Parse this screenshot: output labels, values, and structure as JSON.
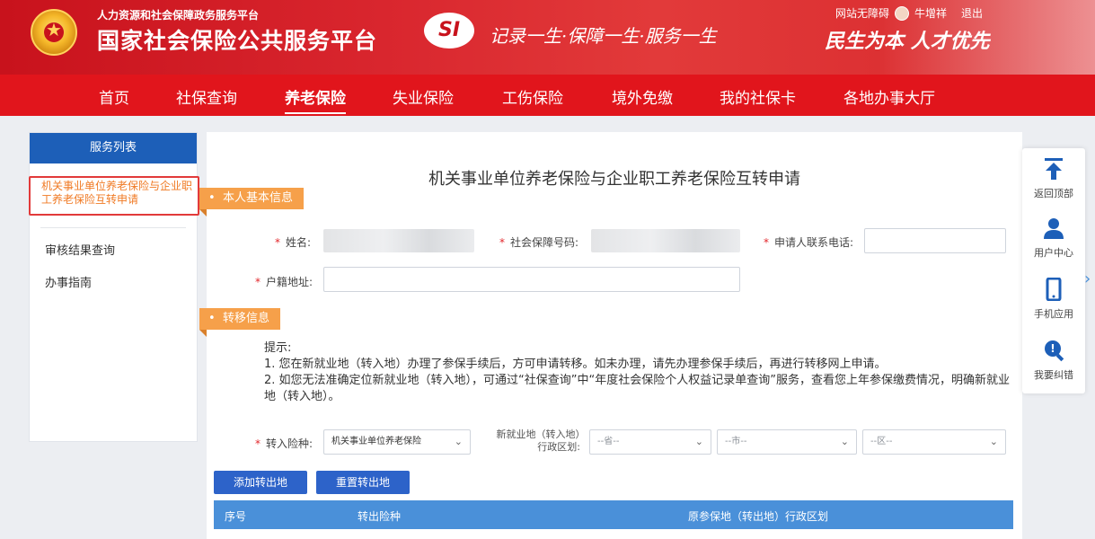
{
  "header": {
    "sub_title": "人力资源和社会保障政务服务平台",
    "main_title": "国家社会保险公共服务平台",
    "si_logo": "SI",
    "slogan": "记录一生·保障一生·服务一生",
    "slogan2": "民生为本 人才优先",
    "barrier_free": "网站无障碍",
    "username": "牛增祥",
    "logout": "退出"
  },
  "nav": {
    "items": [
      "首页",
      "社保查询",
      "养老保险",
      "失业保险",
      "工伤保险",
      "境外免缴",
      "我的社保卡",
      "各地办事大厅"
    ],
    "active_index": 2
  },
  "sidebar": {
    "header": "服务列表",
    "selected_item": "机关事业单位养老保险与企业职工养老保险互转申请",
    "items": [
      "审核结果查询",
      "办事指南"
    ]
  },
  "form": {
    "title": "机关事业单位养老保险与企业职工养老保险互转申请",
    "section_personal": "本人基本信息",
    "section_transfer": "转移信息",
    "labels": {
      "name": "姓名:",
      "social_security_no": "社会保障号码:",
      "phone": "申请人联系电话:",
      "household_address": "户籍地址:",
      "transfer_type": "转入险种:",
      "new_location": "新就业地（转入地）行政区划:"
    },
    "required_mark": "*",
    "values": {
      "transfer_type": "机关事业单位养老保险",
      "province": "--省--",
      "city": "--市--",
      "district": "--区--"
    },
    "hint": {
      "title": "提示:",
      "line1": "1. 您在新就业地（转入地）办理了参保手续后，方可申请转移。如未办理，请先办理参保手续后，再进行转移网上申请。",
      "line2": "2. 如您无法准确定位新就业地（转入地），可通过“社保查询”中“年度社会保险个人权益记录单查询”服务，查看您上年参保缴费情况，明确新就业地（转入地）。"
    },
    "buttons": {
      "add": "添加转出地",
      "reset": "重置转出地"
    },
    "table_headers": [
      "序号",
      "转出险种",
      "原参保地（转出地）行政区划"
    ]
  },
  "float_toolbar": {
    "items": [
      {
        "label": "返回顶部",
        "icon": "back-to-top-icon"
      },
      {
        "label": "用户中心",
        "icon": "user-icon"
      },
      {
        "label": "手机应用",
        "icon": "mobile-icon"
      },
      {
        "label": "我要纠错",
        "icon": "error-report-icon"
      }
    ]
  },
  "colors": {
    "brand_red": "#e1151c",
    "sidebar_blue": "#1d5fb8",
    "section_orange": "#f6a04a",
    "button_blue": "#2d63c9",
    "table_header_blue": "#4a90d9"
  }
}
